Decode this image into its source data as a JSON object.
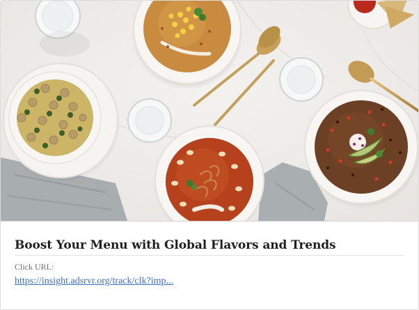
{
  "ad_card": {
    "headline": "Boost Your Menu with Global Flavors and Trends",
    "click_url_label": "Click URL:",
    "click_url": "https://insight.adsrvr.org/track/clk?imp..."
  },
  "hero_image": {
    "subject": "soups-overhead-photo",
    "colors": {
      "marble": "#efedea",
      "napkin": "#a7acae",
      "bowl": "#f8f6f2",
      "tortilla_soup": "#c78a3e",
      "italian_wedding_broth": "#c9b266",
      "tomato_bean_soup": "#b8411b",
      "black_bean_soup": "#6b3f22",
      "spoon_gold": "#c7a05a"
    }
  }
}
